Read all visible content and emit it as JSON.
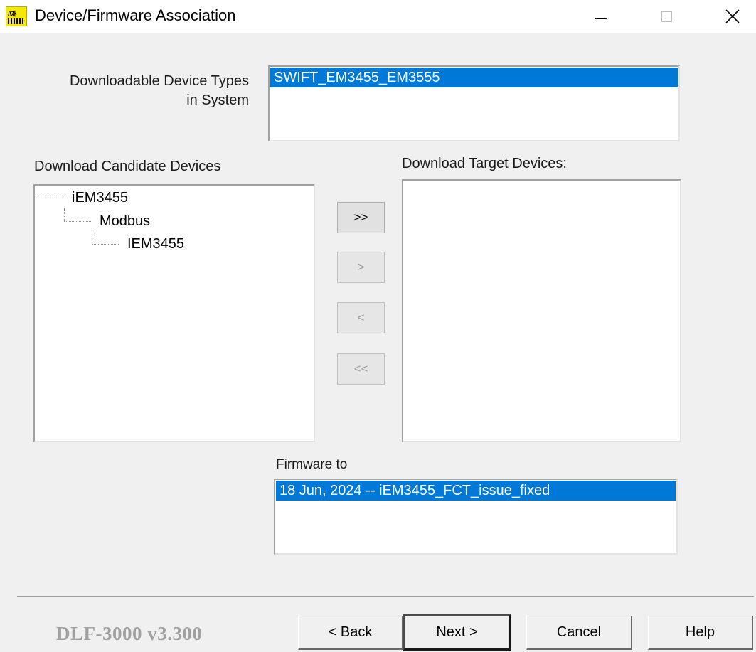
{
  "window": {
    "title": "Device/Firmware Association",
    "icon": "app-icon"
  },
  "device_types": {
    "label_line1": "Downloadable Device Types",
    "label_line2": "in System",
    "items": [
      {
        "label": "SWIFT_EM3455_EM3555",
        "selected": true
      }
    ]
  },
  "candidates": {
    "label": "Download Candidate Devices",
    "tree": [
      {
        "label": "iEM3455",
        "level": 0
      },
      {
        "label": "Modbus",
        "level": 1
      },
      {
        "label": "IEM3455",
        "level": 2
      }
    ]
  },
  "targets": {
    "label": "Download Target Devices:",
    "items": []
  },
  "transfer_buttons": {
    "add_all": ">>",
    "add": ">",
    "remove": "<",
    "remove_all": "<<"
  },
  "firmware": {
    "label": "Firmware to",
    "items": [
      {
        "label": "18 Jun, 2024 -- iEM3455_FCT_issue_fixed",
        "selected": true
      }
    ]
  },
  "footer": {
    "version": "DLF-3000 v3.300",
    "back": "< Back",
    "next": "Next >",
    "cancel": "Cancel",
    "help": "Help"
  },
  "colors": {
    "selection": "#0078d7",
    "background": "#f0f0f0"
  }
}
